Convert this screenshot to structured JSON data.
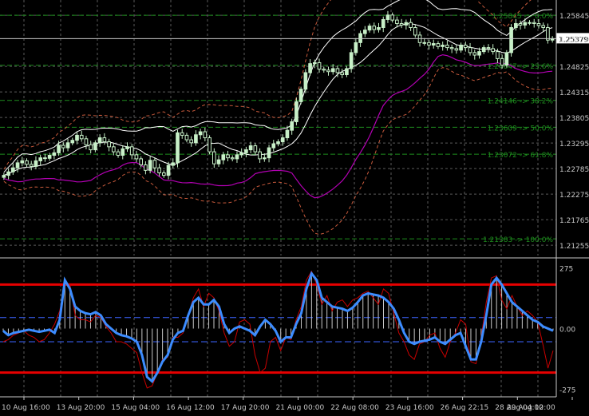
{
  "colors": {
    "background": "#000000",
    "grid": "#5a5a5a",
    "axis": "#c8c8c8",
    "bull_candle": "#c8f0c8",
    "bear_candle": "#000000",
    "wick": "#c8f0c8",
    "bb_outer": "#ffffff",
    "bb_inner_dashed": "#c85a3c",
    "lower_band": "#b400b4",
    "fib": "#1e8c1e",
    "price_line": "#c8c8c8",
    "cci_line": "#3c8cff",
    "cci_signal": "#c80000",
    "cci_hist": "#c8c8c8",
    "level_red": "#e60000",
    "level_blue": "#3c64ff"
  },
  "price_axis": {
    "labels": [
      "1.25845",
      "1.25379",
      "1.24825",
      "1.24315",
      "1.23805",
      "1.23295",
      "1.22785",
      "1.22275",
      "1.21765",
      "1.21255"
    ],
    "current_price": "1.25379"
  },
  "fib_levels": [
    {
      "label": "1.25845 -> 0.0%",
      "value": 1.25845
    },
    {
      "label": "1.24847 -> 23.6%",
      "value": 1.24847
    },
    {
      "label": "1.24146 -> 38.2%",
      "value": 1.24146
    },
    {
      "label": "1.23609 -> 50.0%",
      "value": 1.23609
    },
    {
      "label": "1.23072 -> 61.8%",
      "value": 1.23072
    },
    {
      "label": "1.21383 -> 100.0%",
      "value": 1.21383
    }
  ],
  "indicator_axis": {
    "labels": [
      "275",
      "0.00",
      "-275"
    ],
    "levels": {
      "upper": 200,
      "lower": -200,
      "upper_mid": 50,
      "lower_mid": -60
    }
  },
  "time_axis": {
    "labels": [
      "10 Aug 16:00",
      "13 Aug 20:00",
      "15 Aug 04:00",
      "16 Aug 12:00",
      "17 Aug 20:00",
      "21 Aug 00:00",
      "22 Aug 08:00",
      "23 Aug 16:00",
      "26 Aug 22:15",
      "28 Aug 04:00",
      "29 Aug 12:00"
    ]
  },
  "chart_data": {
    "type": "candlestick",
    "price_range": [
      1.2105,
      1.2615
    ],
    "indicator_range": [
      -310,
      310
    ],
    "candles_close": [
      1.2265,
      1.2272,
      1.228,
      1.229,
      1.2294,
      1.2287,
      1.2283,
      1.2294,
      1.23,
      1.2299,
      1.2305,
      1.231,
      1.2325,
      1.232,
      1.233,
      1.2335,
      1.2345,
      1.2338,
      1.2326,
      1.2316,
      1.233,
      1.234,
      1.2332,
      1.2322,
      1.2312,
      1.2305,
      1.2318,
      1.2322,
      1.2306,
      1.2298,
      1.2286,
      1.2275,
      1.2295,
      1.228,
      1.227,
      1.2265,
      1.2285,
      1.229,
      1.235,
      1.2345,
      1.2336,
      1.233,
      1.2346,
      1.2352,
      1.234,
      1.2312,
      1.2288,
      1.2296,
      1.2306,
      1.23,
      1.2298,
      1.2306,
      1.231,
      1.2316,
      1.2324,
      1.2312,
      1.2298,
      1.23,
      1.232,
      1.2328,
      1.2332,
      1.234,
      1.2355,
      1.2372,
      1.2412,
      1.2437,
      1.247,
      1.2488,
      1.249,
      1.2477,
      1.2475,
      1.2472,
      1.2478,
      1.247,
      1.2466,
      1.2478,
      1.251,
      1.253,
      1.2548,
      1.2555,
      1.2563,
      1.2556,
      1.256,
      1.2576,
      1.2585,
      1.2575,
      1.2568,
      1.2565,
      1.257,
      1.256,
      1.2545,
      1.253,
      1.253,
      1.2525,
      1.2528,
      1.2522,
      1.2525,
      1.252,
      1.2518,
      1.2515,
      1.2525,
      1.252,
      1.251,
      1.2505,
      1.2512,
      1.252,
      1.2518,
      1.2512,
      1.2498,
      1.2485,
      1.251,
      1.256,
      1.2568,
      1.2565,
      1.257,
      1.257,
      1.2568,
      1.2564,
      1.256,
      1.2535,
      1.2538
    ],
    "cci_values": [
      -10,
      -30,
      -20,
      -15,
      -10,
      -5,
      -10,
      -15,
      -10,
      -5,
      -20,
      40,
      220,
      180,
      100,
      80,
      70,
      65,
      75,
      60,
      20,
      0,
      -20,
      -30,
      -35,
      -45,
      -60,
      -120,
      -220,
      -240,
      -200,
      -150,
      -120,
      -50,
      -20,
      -10,
      60,
      120,
      140,
      110,
      110,
      130,
      100,
      20,
      -20,
      0,
      10,
      0,
      -10,
      -30,
      10,
      40,
      20,
      -10,
      -60,
      -40,
      -40,
      20,
      70,
      180,
      250,
      220,
      140,
      120,
      100,
      95,
      90,
      80,
      95,
      120,
      150,
      160,
      155,
      150,
      140,
      120,
      90,
      40,
      -20,
      -60,
      -70,
      -60,
      -55,
      -50,
      -40,
      -60,
      -70,
      -50,
      -30,
      -20,
      -80,
      -140,
      -140,
      -60,
      60,
      200,
      230,
      200,
      160,
      120,
      100,
      80,
      60,
      40,
      30,
      10,
      0,
      -10
    ],
    "cci_signal": [
      -60,
      -50,
      -30,
      -20,
      -10,
      -30,
      -40,
      -60,
      -50,
      -20,
      20,
      80,
      200,
      200,
      60,
      40,
      40,
      30,
      60,
      50,
      10,
      -20,
      -60,
      -60,
      -70,
      -90,
      -110,
      -200,
      -270,
      -260,
      -200,
      -140,
      -130,
      -40,
      -40,
      -20,
      60,
      140,
      180,
      100,
      160,
      140,
      80,
      -20,
      -80,
      -60,
      30,
      40,
      20,
      -120,
      -200,
      -180,
      -60,
      -40,
      -100,
      -40,
      -50,
      40,
      100,
      220,
      260,
      200,
      110,
      150,
      80,
      120,
      130,
      100,
      130,
      140,
      160,
      170,
      140,
      110,
      180,
      160,
      70,
      -20,
      -60,
      -120,
      -140,
      -70,
      -60,
      -30,
      -20,
      -90,
      -130,
      -60,
      -20,
      40,
      20,
      -150,
      -160,
      -40,
      120,
      230,
      240,
      130,
      90,
      150,
      100,
      60,
      80,
      60,
      30,
      -70,
      -180,
      -100
    ]
  }
}
